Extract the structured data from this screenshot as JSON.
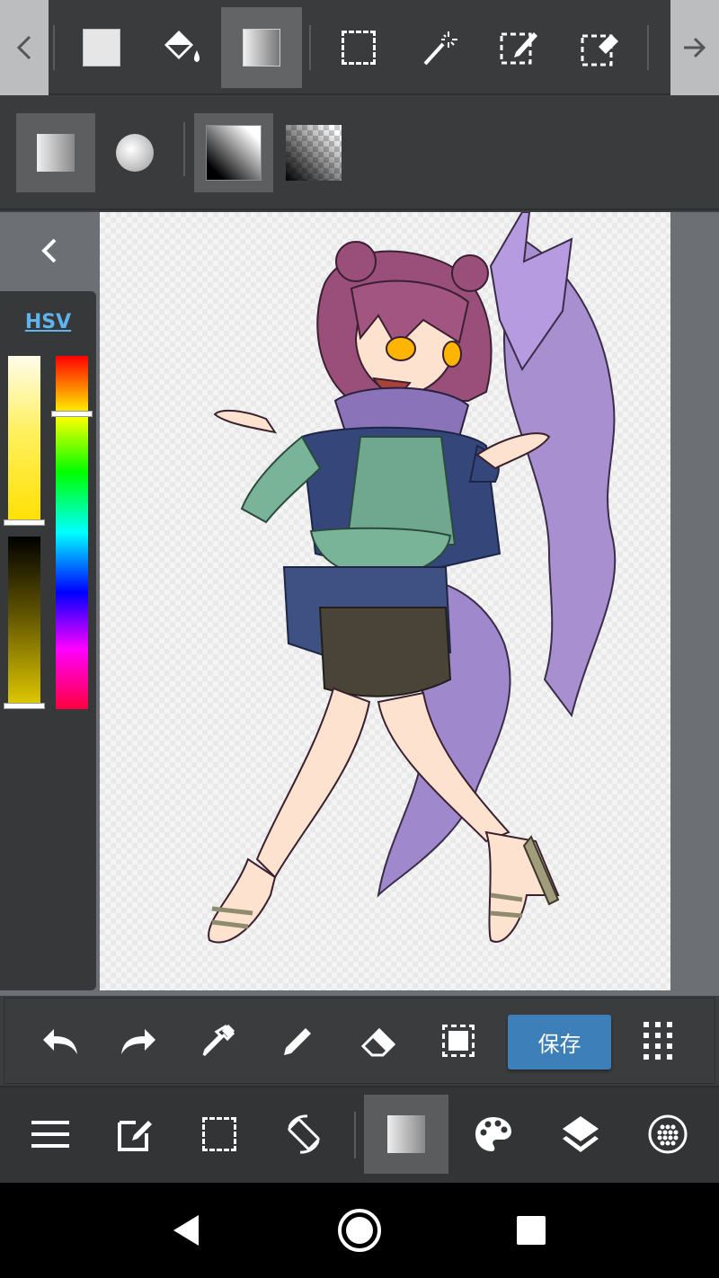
{
  "colors": {
    "accent": "#3d7fb8",
    "hsv_link": "#5fb4ee",
    "toolbar_bg": "#3a3b3d",
    "workspace_bg": "#6c6f73"
  },
  "top_toolbar": {
    "tools": [
      {
        "icon": "fill-square-icon",
        "active": false
      },
      {
        "icon": "paint-bucket-icon",
        "active": false
      },
      {
        "icon": "gradient-icon",
        "active": true
      },
      {
        "icon": "rect-select-icon",
        "active": false
      },
      {
        "icon": "magic-wand-icon",
        "active": false
      },
      {
        "icon": "select-pen-icon",
        "active": false
      },
      {
        "icon": "select-eraser-icon",
        "active": false
      }
    ]
  },
  "gradient_options": {
    "shapes": [
      {
        "icon": "linear-gradient-icon",
        "active": true
      },
      {
        "icon": "radial-gradient-icon",
        "active": false
      }
    ],
    "modes": [
      {
        "icon": "fg-to-bg-icon",
        "active": true
      },
      {
        "icon": "fg-to-transparent-icon",
        "active": false
      }
    ]
  },
  "color_panel": {
    "mode_label": "HSV",
    "saturation": 0.97,
    "value": 0.02,
    "hue": 0.17
  },
  "action_bar": {
    "save_label": "保存"
  },
  "bottom_toolbar": {
    "items": [
      {
        "icon": "menu-icon"
      },
      {
        "icon": "edit-icon"
      },
      {
        "icon": "selection-icon"
      },
      {
        "icon": "rotate-screen-icon"
      },
      {
        "icon": "gradient-tool-icon",
        "active": true
      },
      {
        "icon": "palette-icon"
      },
      {
        "icon": "layers-icon"
      },
      {
        "icon": "material-icon"
      }
    ]
  }
}
